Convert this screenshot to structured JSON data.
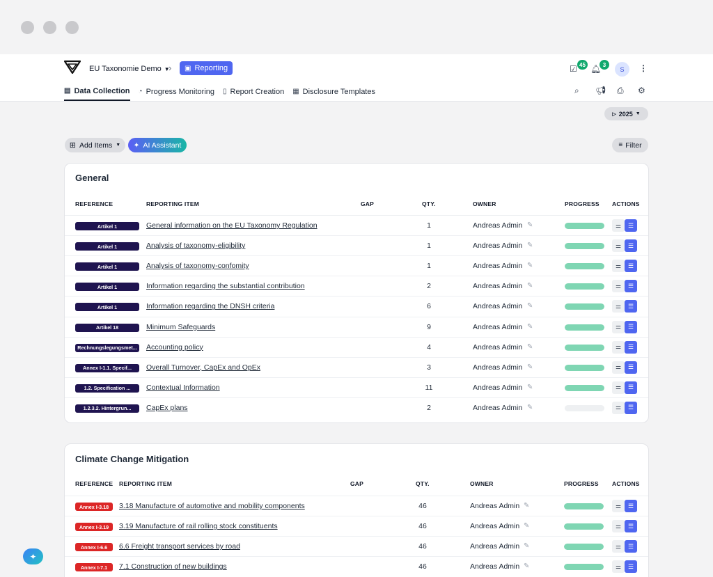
{
  "window": {
    "dots": 3
  },
  "header": {
    "breadcrumb": "EU Taxonomie Demo",
    "module": "Reporting",
    "tasks_badge": "45",
    "notifications_badge": "3",
    "avatar_initial": "S"
  },
  "tabs": [
    {
      "label": "Data Collection",
      "active": true,
      "icon": "clipboard-icon"
    },
    {
      "label": "Progress Monitoring",
      "active": false,
      "icon": "gauge-icon"
    },
    {
      "label": "Report Creation",
      "active": false,
      "icon": "document-icon"
    },
    {
      "label": "Disclosure Templates",
      "active": false,
      "icon": "table-icon"
    }
  ],
  "toolbar": {
    "year": "2025",
    "add_items": "Add Items",
    "ai_assistant": "AI Assistant",
    "filter": "Filter"
  },
  "colors": {
    "accent": "#4f66f0",
    "ref_navy": "#1f1450",
    "ref_red": "#dc2626",
    "progress": "#7fd6b3",
    "badge": "#10a86d"
  },
  "columns": {
    "reference": "REFERENCE",
    "item": "REPORTING ITEM",
    "gap": "GAP",
    "qty": "QTY.",
    "owner": "OWNER",
    "progress": "PROGRESS",
    "actions": "ACTIONS"
  },
  "sections": [
    {
      "title": "General",
      "rows": [
        {
          "ref": "Artikel 1",
          "ref_color": "navy",
          "item": "General information on the EU Taxonomy Regulation",
          "qty": "1",
          "owner": "Andreas Admin",
          "progress": 1.0
        },
        {
          "ref": "Artikel 1",
          "ref_color": "navy",
          "item": "Analysis of taxonomy-eligibility",
          "qty": "1",
          "owner": "Andreas Admin",
          "progress": 1.0
        },
        {
          "ref": "Artikel 1",
          "ref_color": "navy",
          "item": "Analysis of taxonomy-confomity",
          "qty": "1",
          "owner": "Andreas Admin",
          "progress": 1.0
        },
        {
          "ref": "Artikel 1",
          "ref_color": "navy",
          "item": "Information regarding the substantial contribution",
          "qty": "2",
          "owner": "Andreas Admin",
          "progress": 1.0
        },
        {
          "ref": "Artikel 1",
          "ref_color": "navy",
          "item": "Information regarding the DNSH criteria",
          "qty": "6",
          "owner": "Andreas Admin",
          "progress": 1.0
        },
        {
          "ref": "Artikel 18",
          "ref_color": "navy",
          "item": "Minimum Safeguards",
          "qty": "9",
          "owner": "Andreas Admin",
          "progress": 1.0
        },
        {
          "ref": "Rechnungslegungsmet...",
          "ref_color": "navy",
          "item": "Accounting policy",
          "qty": "4",
          "owner": "Andreas Admin",
          "progress": 1.0
        },
        {
          "ref": "Annex I-1.1. Specif...",
          "ref_color": "navy",
          "item": "Overall Turnover, CapEx and OpEx",
          "qty": "3",
          "owner": "Andreas Admin",
          "progress": 1.0
        },
        {
          "ref": "1.2. Specification ...",
          "ref_color": "navy",
          "item": "Contextual Information",
          "qty": "11",
          "owner": "Andreas Admin",
          "progress": 1.0
        },
        {
          "ref": "1.2.3.2. Hintergrun...",
          "ref_color": "navy",
          "item": "CapEx plans",
          "qty": "2",
          "owner": "Andreas Admin",
          "progress": 0.0
        }
      ]
    },
    {
      "title": "Climate Change Mitigation",
      "rows": [
        {
          "ref": "Annex I-3.18",
          "ref_color": "red",
          "item": "3.18 Manufacture of automotive and mobility components",
          "qty": "46",
          "owner": "Andreas Admin",
          "progress": 1.0
        },
        {
          "ref": "Annex I-3.19",
          "ref_color": "red",
          "item": "3.19 Manufacture of rail rolling stock constituents",
          "qty": "46",
          "owner": "Andreas Admin",
          "progress": 1.0
        },
        {
          "ref": "Annex I-6.6",
          "ref_color": "red",
          "item": "6.6 Freight transport services by road",
          "qty": "46",
          "owner": "Andreas Admin",
          "progress": 1.0
        },
        {
          "ref": "Annex I-7.1",
          "ref_color": "red",
          "item": "7.1 Construction of new buildings",
          "qty": "46",
          "owner": "Andreas Admin",
          "progress": 1.0
        }
      ]
    }
  ]
}
